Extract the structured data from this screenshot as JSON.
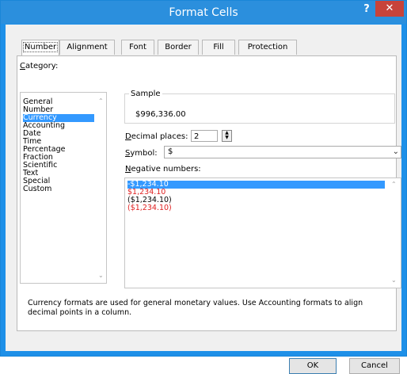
{
  "window": {
    "title": "Format Cells",
    "help_label": "?",
    "close_label": "✕"
  },
  "tabs": [
    {
      "label": "Number"
    },
    {
      "label": "Alignment"
    },
    {
      "label": "Font"
    },
    {
      "label": "Border"
    },
    {
      "label": "Fill"
    },
    {
      "label": "Protection"
    }
  ],
  "category": {
    "label_first": "C",
    "label_rest": "ategory:",
    "items": [
      "General",
      "Number",
      "Currency",
      "Accounting",
      "Date",
      "Time",
      "Percentage",
      "Fraction",
      "Scientific",
      "Text",
      "Special",
      "Custom"
    ],
    "selected": "Currency"
  },
  "sample": {
    "label": "Sample",
    "value": "$996,336.00"
  },
  "decimal_places": {
    "label_first": "D",
    "label_rest": "ecimal places:",
    "value": "2"
  },
  "symbol": {
    "label_first": "S",
    "label_rest": "ymbol:",
    "value": "$"
  },
  "negative_numbers": {
    "label_first": "N",
    "label_rest": "egative numbers:",
    "items": [
      "-$1,234.10",
      "$1,234.10",
      "($1,234.10)",
      "($1,234.10)"
    ]
  },
  "description": "Currency formats are used for general monetary values.  Use Accounting formats to align decimal points in a column.",
  "buttons": {
    "ok": "OK",
    "cancel": "Cancel"
  },
  "colors": {
    "titlebar": "#2b8fdd",
    "close": "#c7433a",
    "selection": "#3399ff",
    "negative_red": "#e02020"
  }
}
